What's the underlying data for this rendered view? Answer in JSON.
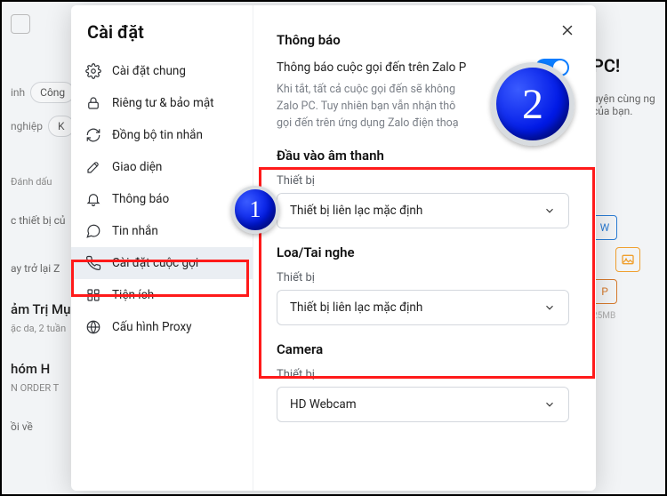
{
  "colors": {
    "accent": "#0a7cff",
    "highlight": "#ff1a1a",
    "badge": "#0019e6"
  },
  "background": {
    "chips": [
      "Công",
      "K"
    ],
    "left_fragments": [
      "inh",
      "nghiệp",
      "Đánh dấu",
      "c thiết bị củ",
      "ay trở lại Z",
      "ảm Trị Mụ",
      "ặc da, 2 tuần",
      "hóm   H",
      "N ORDER T",
      "ồi về",
      "H"
    ],
    "right_fragments": [
      "PC!",
      "uyện cùng ng",
      "của bạn."
    ],
    "file_icons": [
      "W",
      "",
      "P"
    ],
    "file_meta": "25MB"
  },
  "modal": {
    "title": "Cài đặt",
    "close_aria": "Đóng",
    "nav": [
      {
        "icon": "gear",
        "label": "Cài đặt chung"
      },
      {
        "icon": "lock",
        "label": "Riêng tư & bảo mật"
      },
      {
        "icon": "sync",
        "label": "Đồng bộ tin nhắn"
      },
      {
        "icon": "brush",
        "label": "Giao diện"
      },
      {
        "icon": "bell",
        "label": "Thông báo"
      },
      {
        "icon": "message",
        "label": "Tin nhắn"
      },
      {
        "icon": "phone",
        "label": "Cài đặt cuộc gọi",
        "active": true
      },
      {
        "icon": "grid",
        "label": "Tiện ích"
      },
      {
        "icon": "proxy",
        "label": "Cấu hình Proxy"
      }
    ]
  },
  "content": {
    "notif_title": "Thông báo",
    "notif_label": "Thông báo cuộc gọi đến trên Zalo P",
    "notif_toggle_on": true,
    "notif_hint": "Khi tắt, tất cả cuộc gọi đến sẽ không\nZalo PC. Tuy nhiên bạn vẫn nhận thô\ngọi đến trên ứng dụng Zalo điện thoạ",
    "audio_in": {
      "title": "Đầu vào âm thanh",
      "device_label": "Thiết bị",
      "device_value": "Thiết bị liên lạc mặc định"
    },
    "audio_out": {
      "title": "Loa/Tai nghe",
      "device_label": "Thiết bị",
      "device_value": "Thiết bị liên lạc mặc định"
    },
    "camera": {
      "title": "Camera",
      "device_label": "Thiết bị",
      "device_value": "HD Webcam"
    }
  },
  "annotations": {
    "badge1": "1",
    "badge2": "2"
  }
}
